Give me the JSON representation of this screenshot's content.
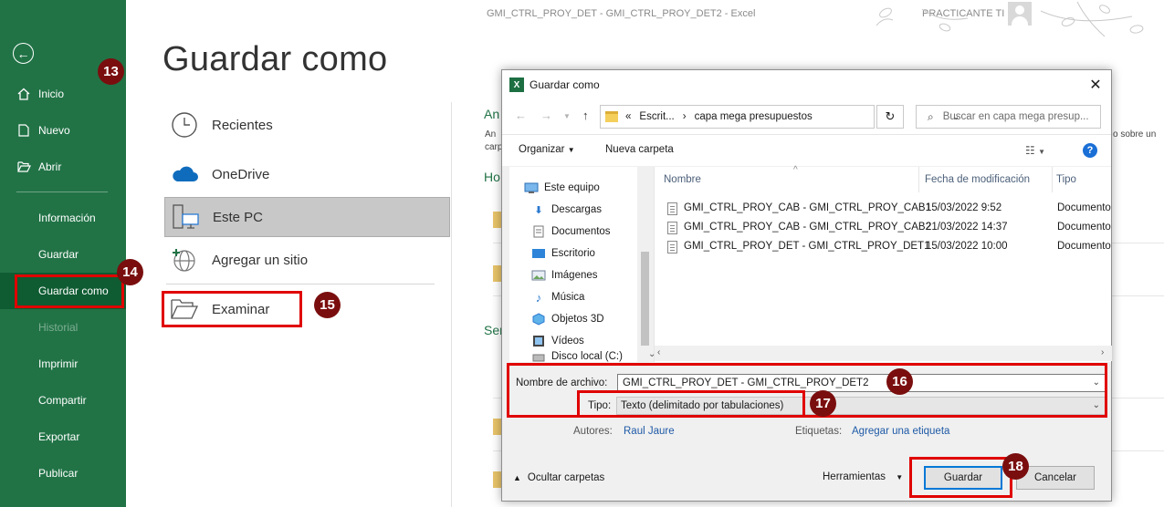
{
  "app": {
    "window_title": "GMI_CTRL_PROY_DET - GMI_CTRL_PROY_DET2  -  Excel",
    "user": "PRACTICANTE TI"
  },
  "sidebar": {
    "items": [
      {
        "label": "Inicio",
        "icon": "home-icon"
      },
      {
        "label": "Nuevo",
        "icon": "new-doc-icon"
      },
      {
        "label": "Abrir",
        "icon": "open-folder-icon"
      },
      {
        "label": "Información"
      },
      {
        "label": "Guardar"
      },
      {
        "label": "Guardar como",
        "active": true
      },
      {
        "label": "Historial",
        "disabled": true
      },
      {
        "label": "Imprimir"
      },
      {
        "label": "Compartir"
      },
      {
        "label": "Exportar"
      },
      {
        "label": "Publicar"
      }
    ]
  },
  "backstage": {
    "title": "Guardar como",
    "places": [
      {
        "label": "Recientes",
        "icon": "clock-icon"
      },
      {
        "label": "OneDrive",
        "icon": "cloud-icon"
      },
      {
        "label": "Este PC",
        "icon": "computer-icon",
        "selected": true
      },
      {
        "label": "Agregar un sitio",
        "icon": "globe-plus-icon"
      },
      {
        "label": "Examinar",
        "icon": "folder-open-icon"
      }
    ]
  },
  "background": {
    "heading_partial": "An",
    "line1": "An",
    "line2": "carp",
    "heading2": "Ho",
    "heading3": "Ser",
    "right_text": "o sobre un"
  },
  "dialog": {
    "title": "Guardar como",
    "address": {
      "root": "«",
      "segments": [
        "Escrit...",
        "capa mega presupuestos"
      ]
    },
    "search_placeholder": "Buscar en capa mega presup...",
    "toolbar": {
      "organize": "Organizar",
      "new_folder": "Nueva carpeta"
    },
    "nav_items": [
      {
        "label": "Este equipo",
        "icon": "computer-icon"
      },
      {
        "label": "Descargas",
        "icon": "download-icon"
      },
      {
        "label": "Documentos",
        "icon": "documents-icon"
      },
      {
        "label": "Escritorio",
        "icon": "desktop-icon"
      },
      {
        "label": "Imágenes",
        "icon": "pictures-icon"
      },
      {
        "label": "Música",
        "icon": "music-icon"
      },
      {
        "label": "Objetos 3D",
        "icon": "cube-icon"
      },
      {
        "label": "Vídeos",
        "icon": "video-icon"
      },
      {
        "label": "Disco local (C:)",
        "icon": "disk-icon"
      }
    ],
    "columns": {
      "name": "Nombre",
      "date": "Fecha de modificación",
      "type": "Tipo"
    },
    "files": [
      {
        "name": "GMI_CTRL_PROY_CAB - GMI_CTRL_PROY_CAB1",
        "date": "15/03/2022 9:52",
        "type": "Documento"
      },
      {
        "name": "GMI_CTRL_PROY_CAB - GMI_CTRL_PROY_CAB2",
        "date": "21/03/2022 14:37",
        "type": "Documento"
      },
      {
        "name": "GMI_CTRL_PROY_DET - GMI_CTRL_PROY_DET1",
        "date": "15/03/2022 10:00",
        "type": "Documento"
      }
    ],
    "filename_label": "Nombre de archivo:",
    "filename_value": "GMI_CTRL_PROY_DET - GMI_CTRL_PROY_DET2",
    "type_label": "Tipo:",
    "type_value": "Texto (delimitado por tabulaciones)",
    "authors_label": "Autores:",
    "authors_value": "Raul Jaure",
    "tags_label": "Etiquetas:",
    "tags_value": "Agregar una etiqueta",
    "hide_folders": "Ocultar carpetas",
    "tools": "Herramientas",
    "save": "Guardar",
    "cancel": "Cancelar"
  },
  "annotations": [
    "13",
    "14",
    "15",
    "16",
    "17",
    "18"
  ],
  "colors": {
    "excel_green": "#217346",
    "annotation_red": "#e00000",
    "badge": "#7a0e0e",
    "accent_blue": "#0078d7"
  }
}
